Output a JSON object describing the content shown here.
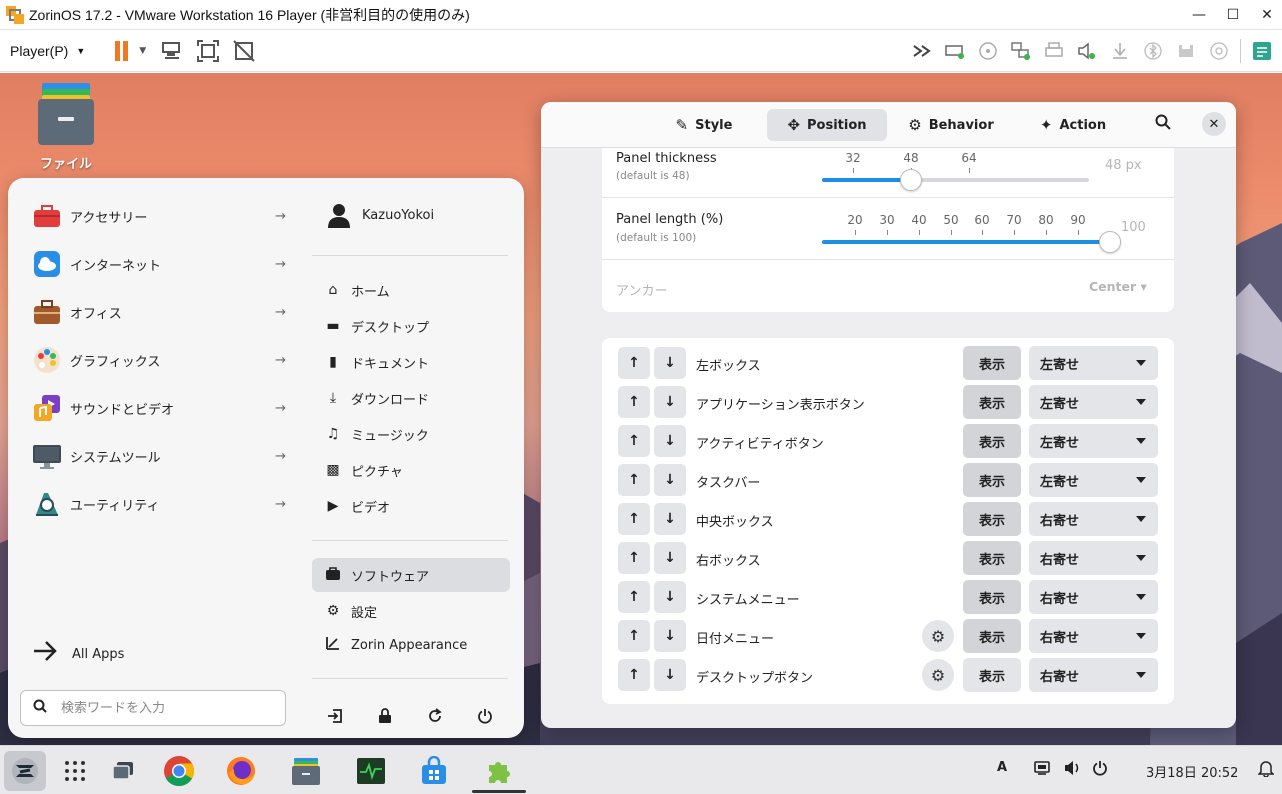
{
  "window": {
    "title": "ZorinOS 17.2 - VMware Workstation 16 Player (非営利目的の使用のみ)",
    "minimize": "—",
    "maximize": "☐",
    "close": "✕"
  },
  "toolbar": {
    "player_label": "Player(P)",
    "pause_color": "#f07820"
  },
  "desktop": {
    "file_icon_label": "ファイル"
  },
  "start_menu": {
    "categories": [
      {
        "label": "アクセサリー",
        "arrow": "→",
        "color": "#e33b3b"
      },
      {
        "label": "インターネット",
        "arrow": "→",
        "color": "#2a8ee6"
      },
      {
        "label": "オフィス",
        "arrow": "→",
        "color": "#a15a2c"
      },
      {
        "label": "グラフィックス",
        "arrow": "→",
        "color": "#f2d4b0"
      },
      {
        "label": "サウンドとビデオ",
        "arrow": "→",
        "color": "#f5a623"
      },
      {
        "label": "システムツール",
        "arrow": "→",
        "color": "#3e4a55"
      },
      {
        "label": "ユーティリティ",
        "arrow": "→",
        "color": "#2e8b80"
      }
    ],
    "all_apps": "All Apps",
    "search_placeholder": "検索ワードを入力",
    "user_name": "KazuoYokoi",
    "places": [
      {
        "label": "ホーム",
        "icon": "⌂"
      },
      {
        "label": "デスクトップ",
        "icon": "▬"
      },
      {
        "label": "ドキュメント",
        "icon": "▮"
      },
      {
        "label": "ダウンロード",
        "icon": "⤓"
      },
      {
        "label": "ミュージック",
        "icon": "♫"
      },
      {
        "label": "ピクチャ",
        "icon": "▩"
      },
      {
        "label": "ビデオ",
        "icon": "▶"
      }
    ],
    "software": "ソフトウェア",
    "settings": "設定",
    "appearance": "Zorin Appearance"
  },
  "settings_panel": {
    "tabs": [
      {
        "label": "Style",
        "icon": "✎"
      },
      {
        "label": "Position",
        "icon": "✥"
      },
      {
        "label": "Behavior",
        "icon": "⚙"
      },
      {
        "label": "Action",
        "icon": "✦"
      }
    ],
    "active_tab": "Position",
    "thickness": {
      "title": "Panel thickness",
      "subtitle": "(default is 48)",
      "ticks": [
        "32",
        "48",
        "64"
      ],
      "value_label": "48 px",
      "value": 48
    },
    "length": {
      "title": "Panel length (%)",
      "subtitle": "(default is 100)",
      "ticks": [
        "20",
        "30",
        "40",
        "50",
        "60",
        "70",
        "80",
        "90"
      ],
      "value_label": "100",
      "value": 100
    },
    "anchor": {
      "label": "アンカー",
      "value": "Center ▾"
    },
    "up_arrow": "↑",
    "down_arrow": "↓",
    "show_label": "表示",
    "elements": [
      {
        "label": "左ボックス",
        "align": "左寄せ"
      },
      {
        "label": "アプリケーション表示ボタン",
        "align": "左寄せ"
      },
      {
        "label": "アクティビティボタン",
        "align": "左寄せ"
      },
      {
        "label": "タスクバー",
        "align": "左寄せ"
      },
      {
        "label": "中央ボックス",
        "align": "右寄せ"
      },
      {
        "label": "右ボックス",
        "align": "右寄せ"
      },
      {
        "label": "システムメニュー",
        "align": "右寄せ"
      },
      {
        "label": "日付メニュー",
        "align": "右寄せ"
      },
      {
        "label": "デスクトップボタン",
        "align": "右寄せ"
      }
    ]
  },
  "taskbar": {
    "keyboard_indicator": "A",
    "clock": "3月18日  20:52"
  }
}
